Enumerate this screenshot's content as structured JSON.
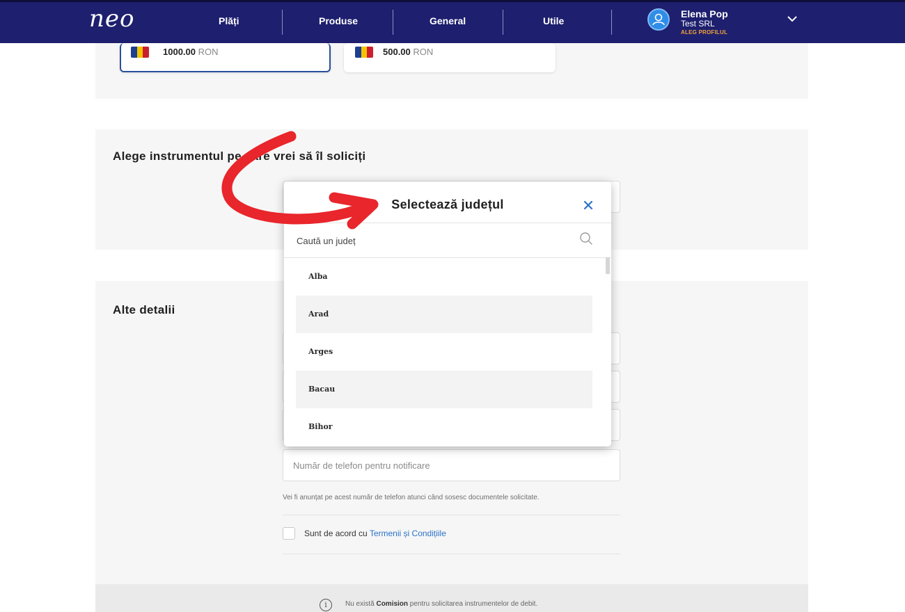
{
  "header": {
    "logo": "neo",
    "nav": [
      "Plăți",
      "Produse",
      "General",
      "Utile"
    ],
    "profile": {
      "name": "Elena Pop",
      "company": "Test SRL",
      "link": "ALEG PROFILUL"
    }
  },
  "amounts": [
    {
      "value": "1000.00",
      "currency": "RON",
      "selected": true
    },
    {
      "value": "500.00",
      "currency": "RON",
      "selected": false
    }
  ],
  "sections": {
    "instrument_title": "Alege instrumentul pe care vrei să îl soliciți",
    "details_title": "Alte detalii"
  },
  "form": {
    "phone_placeholder": "Număr de telefon pentru notificare",
    "phone_helper": "Vei fi anunțat pe acest număr de telefon atunci când sosesc documentele solicitate.",
    "terms_prefix": "Sunt de acord cu ",
    "terms_link": "Termenii și Condițiile"
  },
  "footer": {
    "pre": "Nu există ",
    "bold": "Comision",
    "post": " pentru solicitarea instrumentelor de debit."
  },
  "modal": {
    "title": "Selectează județul",
    "search_placeholder": "Caută un județ",
    "items": [
      "Alba",
      "Arad",
      "Arges",
      "Bacau",
      "Bihor"
    ]
  },
  "colors": {
    "nav_bg": "#1e1f6e",
    "accent_blue": "#2b72c9",
    "profile_link": "#f2a33a",
    "annotation_arrow": "#e8262b"
  },
  "icons": [
    "avatar-user-icon",
    "chevron-down-icon",
    "close-icon",
    "search-icon",
    "info-icon",
    "romania-flag-icon",
    "curved-arrow-annotation"
  ]
}
